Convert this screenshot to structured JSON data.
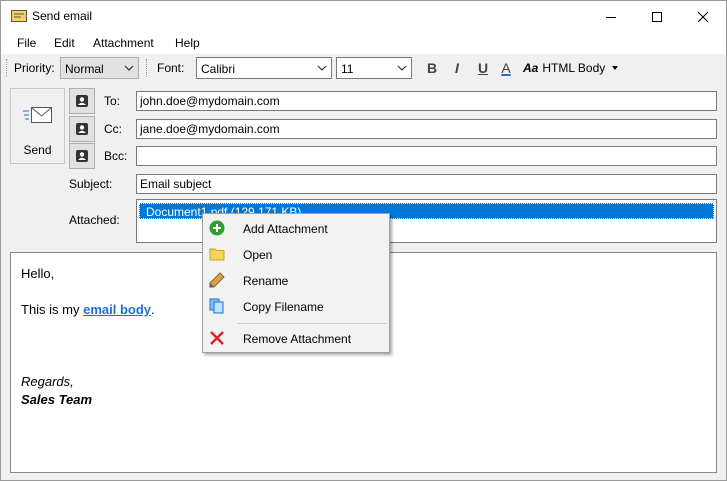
{
  "window": {
    "title": "Send email"
  },
  "menu": [
    "File",
    "Edit",
    "Attachment",
    "Help"
  ],
  "toolbar": {
    "priority_label": "Priority:",
    "priority_value": "Normal",
    "font_label": "Font:",
    "font_value": "Calibri",
    "size_value": "11",
    "bold": "B",
    "italic": "I",
    "underline": "U",
    "font_color": "A",
    "html_body_prefix": "Aa",
    "html_body_label": "HTML Body"
  },
  "header": {
    "send_label": "Send",
    "to_label": "To:",
    "to_value": "john.doe@mydomain.com",
    "cc_label": "Cc:",
    "cc_value": "jane.doe@mydomain.com",
    "bcc_label": "Bcc:",
    "bcc_value": "",
    "subject_label": "Subject:",
    "subject_value": "Email subject",
    "attached_label": "Attached:",
    "attachments": [
      "Document1.pdf (129,171 KB)"
    ]
  },
  "body": {
    "greeting": "Hello,",
    "line_prefix": "This is my ",
    "line_link": "email body",
    "line_suffix": ".",
    "regards": "Regards,",
    "signature": "Sales Team"
  },
  "context_menu": {
    "items": [
      "Add Attachment",
      "Open",
      "Rename",
      "Copy Filename",
      "Remove Attachment"
    ]
  },
  "colors": {
    "selection": "#0078d7",
    "link": "#1f6fcf",
    "add_icon": "#2f9e2f",
    "remove_icon": "#d9262b",
    "folder_icon": "#f5d35a"
  },
  "icons": {
    "title": "email-icon",
    "contact": "contact-card-icon",
    "send": "send-envelope-icon",
    "ctx": [
      "add-icon",
      "folder-icon",
      "pencil-icon",
      "copy-icon",
      "remove-icon"
    ]
  }
}
